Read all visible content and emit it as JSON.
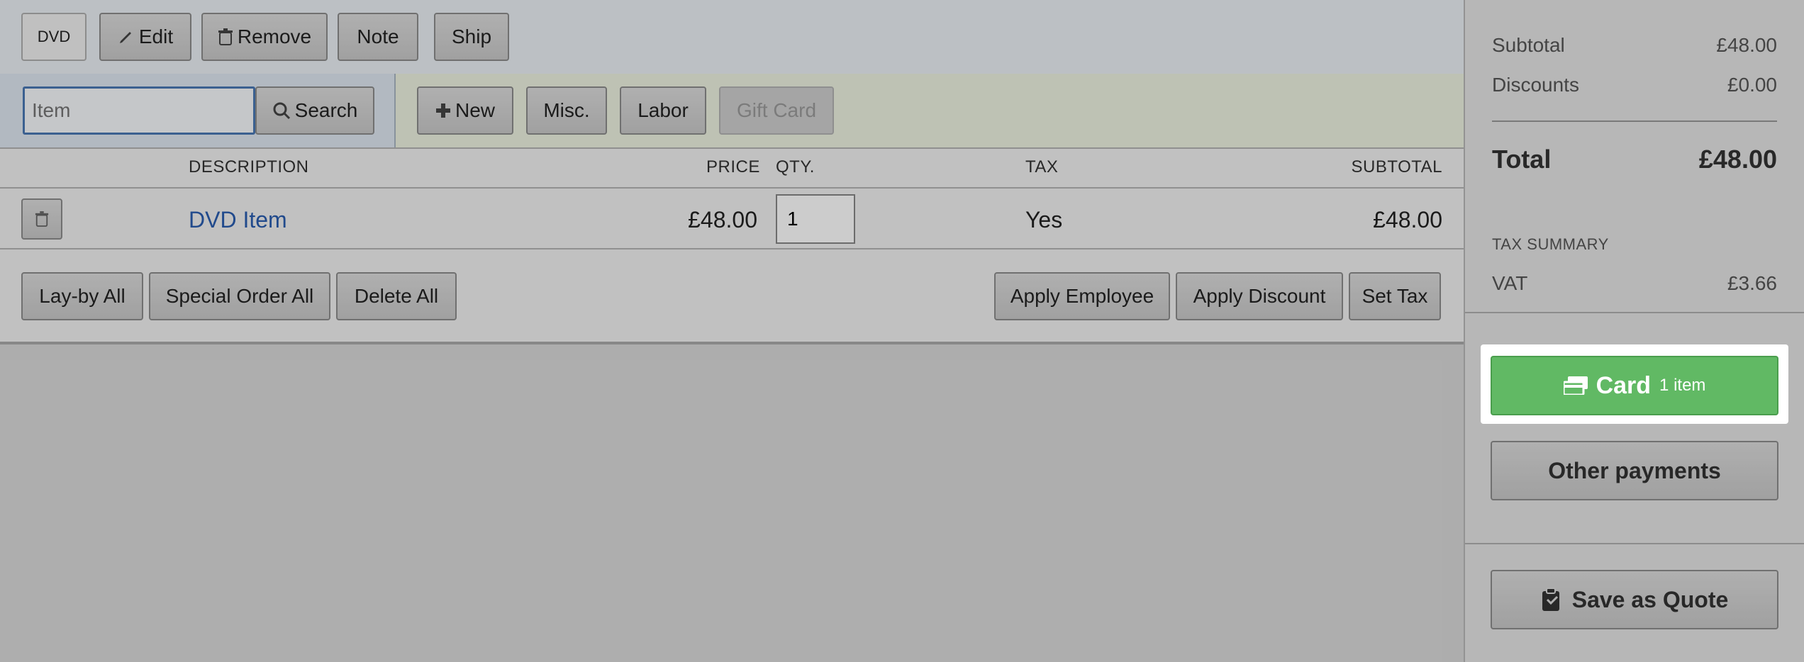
{
  "toolbar": {
    "type_badge": "DVD",
    "edit_label": "Edit",
    "remove_label": "Remove",
    "note_label": "Note",
    "ship_label": "Ship"
  },
  "search": {
    "placeholder": "Item",
    "value": "",
    "button_label": "Search"
  },
  "add_buttons": {
    "new_label": "New",
    "misc_label": "Misc.",
    "labor_label": "Labor",
    "gift_card_label": "Gift Card"
  },
  "table": {
    "headers": {
      "description": "DESCRIPTION",
      "price": "PRICE",
      "qty": "QTY.",
      "tax": "TAX",
      "subtotal": "SUBTOTAL"
    },
    "rows": [
      {
        "description": "DVD Item",
        "price": "£48.00",
        "qty": "1",
        "tax": "Yes",
        "subtotal": "£48.00"
      }
    ]
  },
  "bulk_actions": {
    "layby_all": "Lay-by All",
    "special_order_all": "Special Order All",
    "delete_all": "Delete All",
    "apply_employee": "Apply Employee",
    "apply_discount": "Apply Discount",
    "set_tax": "Set Tax"
  },
  "summary": {
    "subtotal_label": "Subtotal",
    "subtotal_value": "£48.00",
    "discounts_label": "Discounts",
    "discounts_value": "£0.00",
    "total_label": "Total",
    "total_value": "£48.00",
    "tax_summary_heading": "TAX SUMMARY",
    "vat_label": "VAT",
    "vat_value": "£3.66"
  },
  "payments": {
    "card_label": "Card",
    "card_count": "1 item",
    "other_label": "Other payments",
    "quote_label": "Save as Quote"
  },
  "colors": {
    "accent_green": "#61b964",
    "link_blue": "#2a5db0"
  },
  "icons": [
    "pencil-icon",
    "trash-icon",
    "search-icon",
    "plus-icon",
    "credit-card-icon",
    "clipboard-icon"
  ]
}
